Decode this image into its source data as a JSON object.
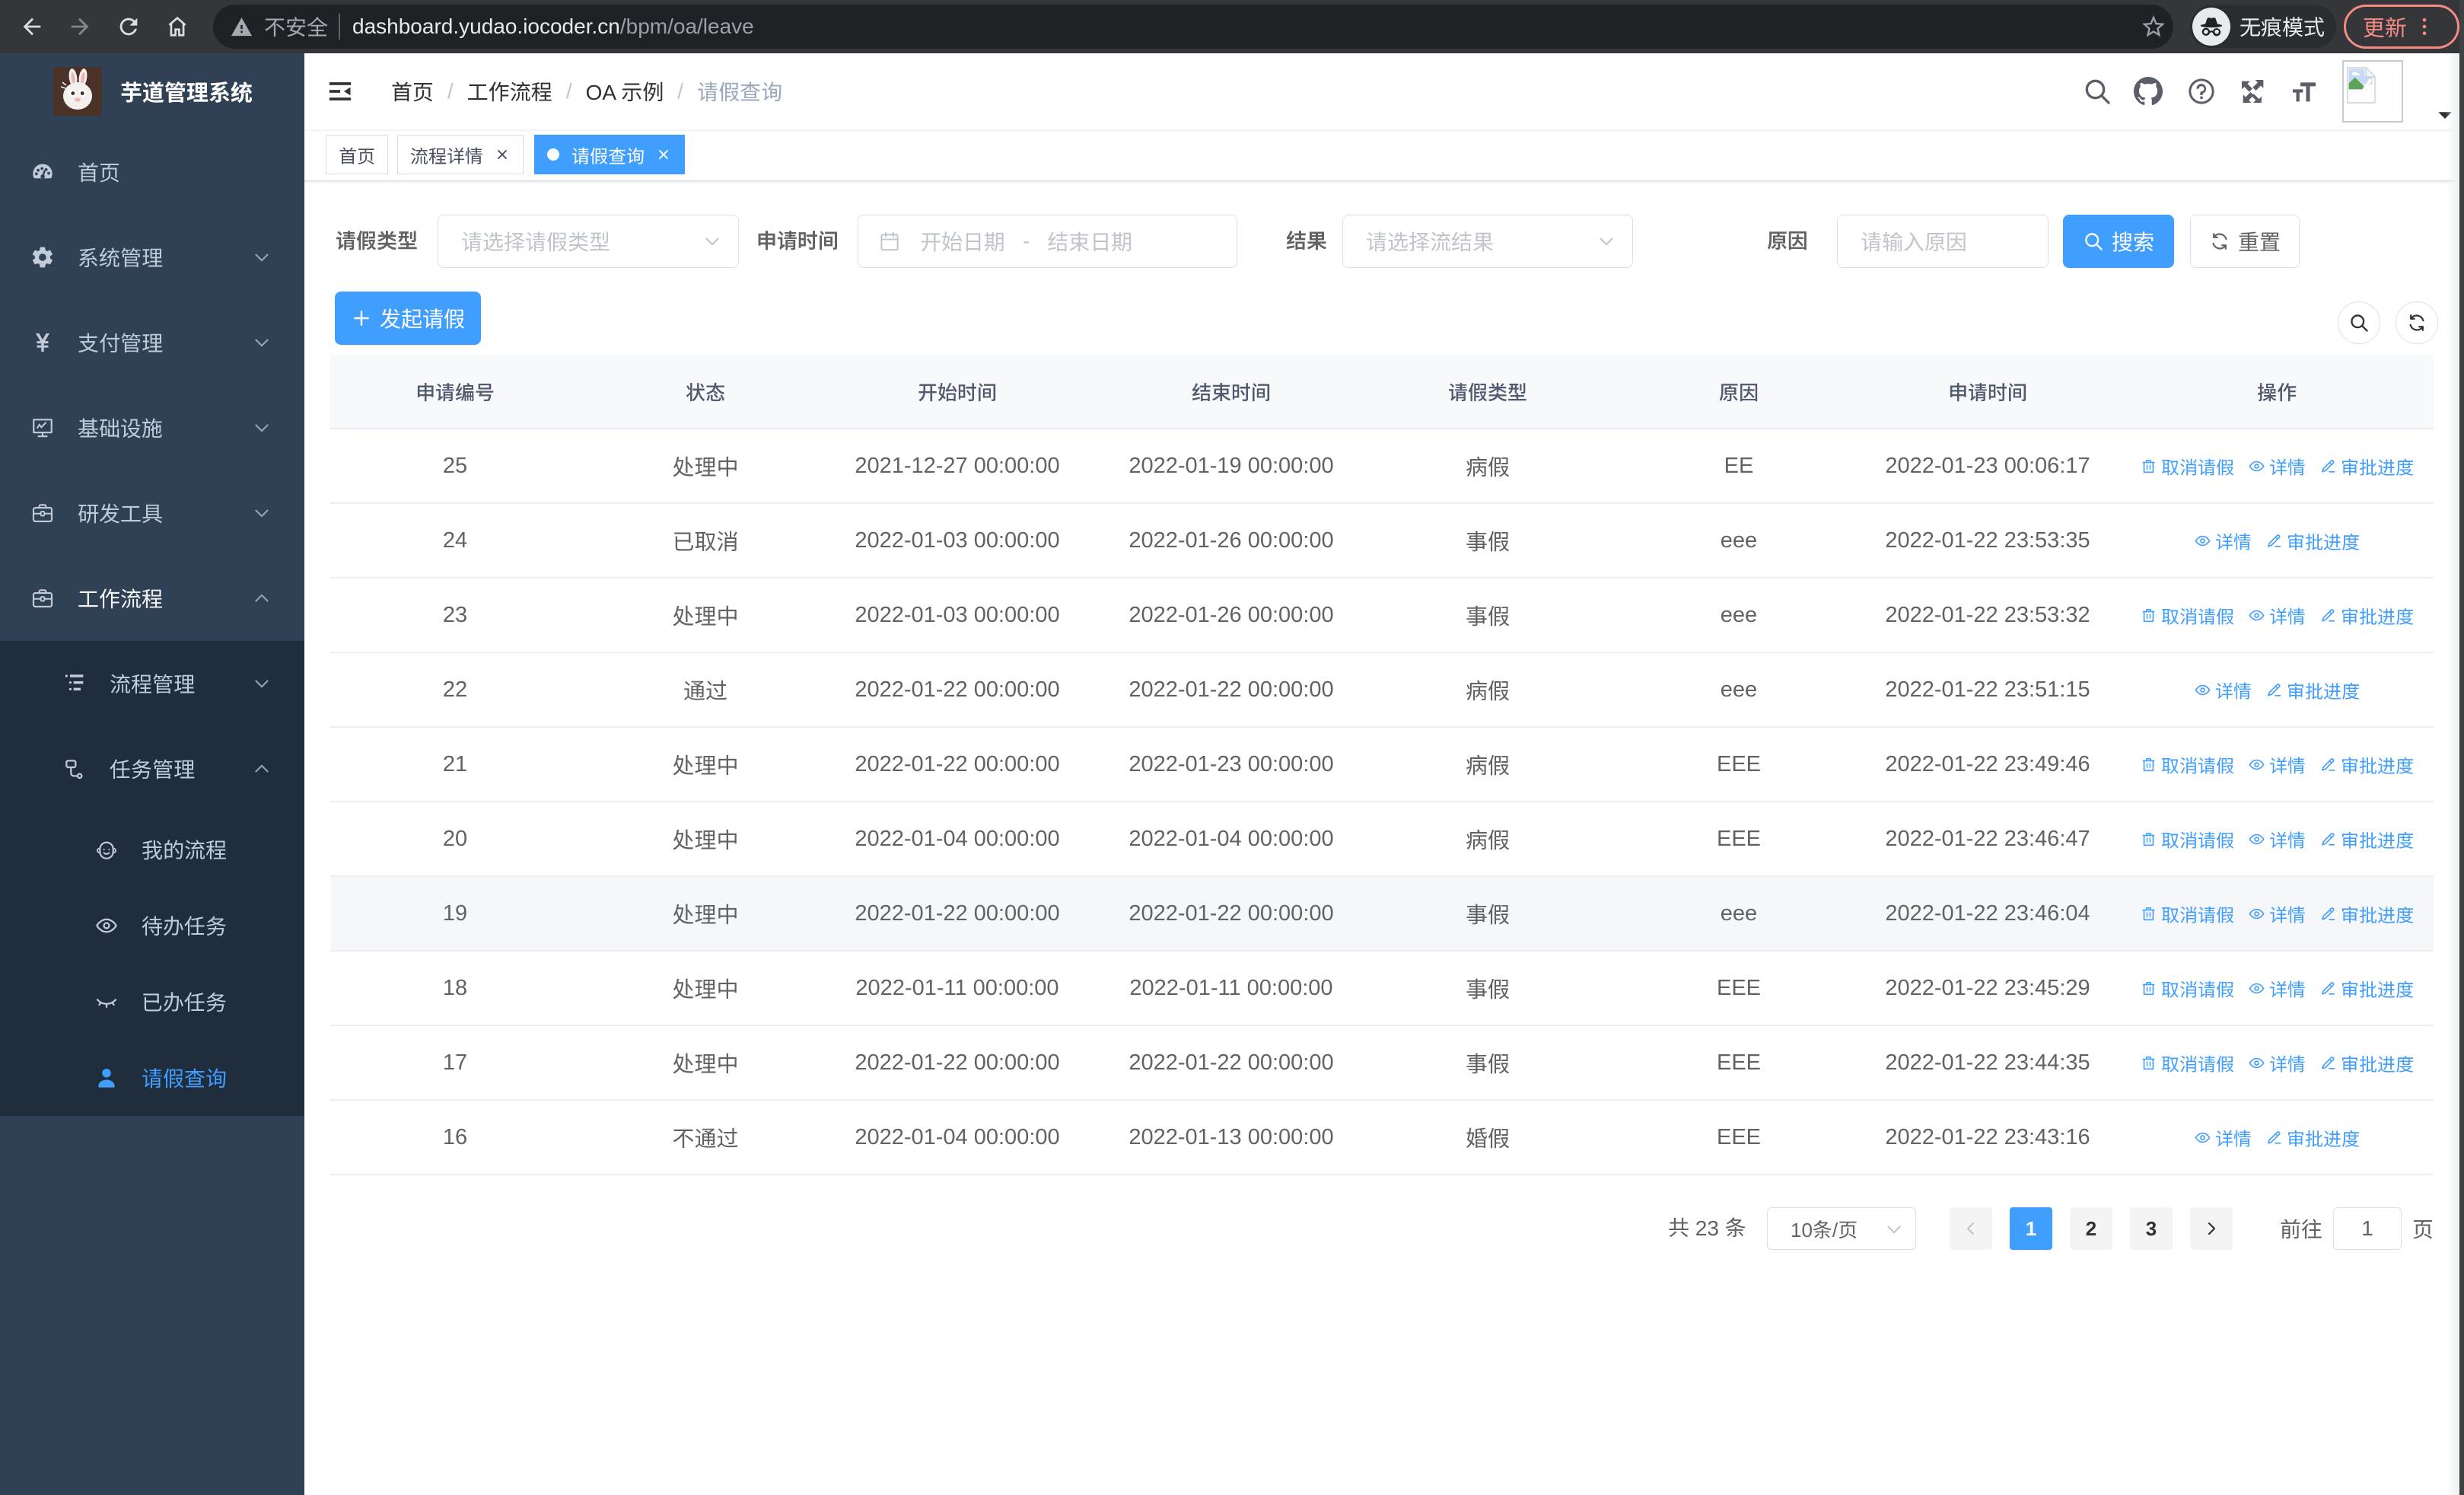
{
  "browser": {
    "security_label": "不安全",
    "url_host": "dashboard.yudao.iocoder.cn",
    "url_path": "/bpm/oa/leave",
    "incognito_label": "无痕模式",
    "update_label": "更新"
  },
  "sidebar": {
    "logo_title": "芋道管理系统",
    "items": [
      {
        "label": "首页"
      },
      {
        "label": "系统管理"
      },
      {
        "label": "支付管理"
      },
      {
        "label": "基础设施"
      },
      {
        "label": "研发工具"
      },
      {
        "label": "工作流程"
      },
      {
        "label": "流程管理"
      },
      {
        "label": "任务管理"
      },
      {
        "label": "我的流程"
      },
      {
        "label": "待办任务"
      },
      {
        "label": "已办任务"
      },
      {
        "label": "请假查询"
      }
    ]
  },
  "breadcrumb": {
    "items": [
      "首页",
      "工作流程",
      "OA 示例",
      "请假查询"
    ]
  },
  "tags": [
    {
      "label": "首页",
      "closable": false,
      "active": false
    },
    {
      "label": "流程详情",
      "closable": true,
      "active": false
    },
    {
      "label": "请假查询",
      "closable": true,
      "active": true
    }
  ],
  "filters": {
    "leave_type_label": "请假类型",
    "leave_type_placeholder": "请选择请假类型",
    "apply_time_label": "申请时间",
    "date_start_placeholder": "开始日期",
    "date_separator": "-",
    "date_end_placeholder": "结束日期",
    "result_label": "结果",
    "result_placeholder": "请选择流结果",
    "reason_label": "原因",
    "reason_placeholder": "请输入原因",
    "search_label": "搜索",
    "reset_label": "重置"
  },
  "toolbar": {
    "create_label": "发起请假"
  },
  "table": {
    "columns": [
      "申请编号",
      "状态",
      "开始时间",
      "结束时间",
      "请假类型",
      "原因",
      "申请时间",
      "操作"
    ],
    "action_labels": {
      "cancel": "取消请假",
      "detail": "详情",
      "progress": "审批进度"
    },
    "rows": [
      {
        "id": "25",
        "status": "处理中",
        "start": "2021-12-27 00:00:00",
        "end": "2022-01-19 00:00:00",
        "type": "病假",
        "reason": "EE",
        "applied": "2022-01-23 00:06:17",
        "actions": [
          "cancel",
          "detail",
          "progress"
        ]
      },
      {
        "id": "24",
        "status": "已取消",
        "start": "2022-01-03 00:00:00",
        "end": "2022-01-26 00:00:00",
        "type": "事假",
        "reason": "eee",
        "applied": "2022-01-22 23:53:35",
        "actions": [
          "detail",
          "progress"
        ]
      },
      {
        "id": "23",
        "status": "处理中",
        "start": "2022-01-03 00:00:00",
        "end": "2022-01-26 00:00:00",
        "type": "事假",
        "reason": "eee",
        "applied": "2022-01-22 23:53:32",
        "actions": [
          "cancel",
          "detail",
          "progress"
        ]
      },
      {
        "id": "22",
        "status": "通过",
        "start": "2022-01-22 00:00:00",
        "end": "2022-01-22 00:00:00",
        "type": "病假",
        "reason": "eee",
        "applied": "2022-01-22 23:51:15",
        "actions": [
          "detail",
          "progress"
        ]
      },
      {
        "id": "21",
        "status": "处理中",
        "start": "2022-01-22 00:00:00",
        "end": "2022-01-23 00:00:00",
        "type": "病假",
        "reason": "EEE",
        "applied": "2022-01-22 23:49:46",
        "actions": [
          "cancel",
          "detail",
          "progress"
        ]
      },
      {
        "id": "20",
        "status": "处理中",
        "start": "2022-01-04 00:00:00",
        "end": "2022-01-04 00:00:00",
        "type": "病假",
        "reason": "EEE",
        "applied": "2022-01-22 23:46:47",
        "actions": [
          "cancel",
          "detail",
          "progress"
        ]
      },
      {
        "id": "19",
        "status": "处理中",
        "start": "2022-01-22 00:00:00",
        "end": "2022-01-22 00:00:00",
        "type": "事假",
        "reason": "eee",
        "applied": "2022-01-22 23:46:04",
        "actions": [
          "cancel",
          "detail",
          "progress"
        ]
      },
      {
        "id": "18",
        "status": "处理中",
        "start": "2022-01-11 00:00:00",
        "end": "2022-01-11 00:00:00",
        "type": "事假",
        "reason": "EEE",
        "applied": "2022-01-22 23:45:29",
        "actions": [
          "cancel",
          "detail",
          "progress"
        ]
      },
      {
        "id": "17",
        "status": "处理中",
        "start": "2022-01-22 00:00:00",
        "end": "2022-01-22 00:00:00",
        "type": "事假",
        "reason": "EEE",
        "applied": "2022-01-22 23:44:35",
        "actions": [
          "cancel",
          "detail",
          "progress"
        ]
      },
      {
        "id": "16",
        "status": "不通过",
        "start": "2022-01-04 00:00:00",
        "end": "2022-01-13 00:00:00",
        "type": "婚假",
        "reason": "EEE",
        "applied": "2022-01-22 23:43:16",
        "actions": [
          "detail",
          "progress"
        ]
      }
    ]
  },
  "pagination": {
    "total_label": "共 23 条",
    "page_size_value": "10条/页",
    "pages": [
      "1",
      "2",
      "3"
    ],
    "current_page": "1",
    "jump_prefix": "前往",
    "jump_value": "1",
    "jump_suffix": "页"
  },
  "colors": {
    "primary": "#409eff",
    "sidebar_bg": "#304156",
    "submenu_bg": "#1f2d3d",
    "active_tag": "#409eff",
    "update_accent": "#f28b82"
  }
}
